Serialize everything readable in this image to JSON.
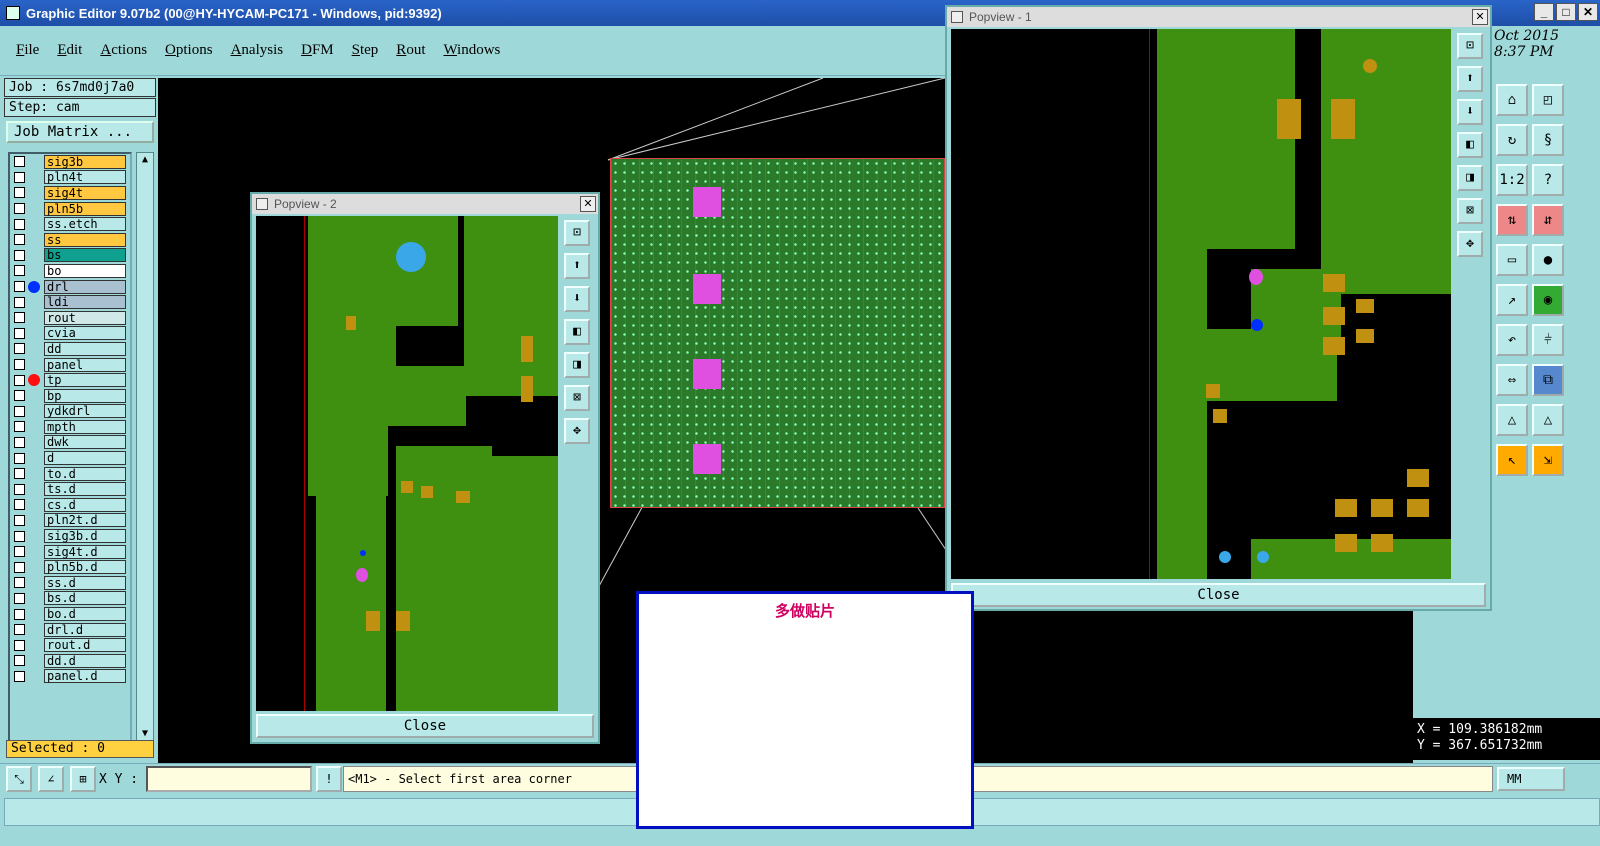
{
  "window": {
    "title": "Graphic Editor 9.07b2 (00@HY-HYCAM-PC171 - Windows, pid:9392)"
  },
  "menu": [
    "File",
    "Edit",
    "Actions",
    "Options",
    "Analysis",
    "DFM",
    "Step",
    "Rout",
    "Windows"
  ],
  "job": {
    "job_label": "Job : 6s7md0j7a0",
    "step_label": "Step: cam",
    "job_matrix": "Job Matrix ..."
  },
  "layers": [
    {
      "name": "sig3b",
      "color": "#ffc840"
    },
    {
      "name": "pln4t",
      "color": "#b8e8e8"
    },
    {
      "name": "sig4t",
      "color": "#ffc840"
    },
    {
      "name": "pln5b",
      "color": "#ffc840"
    },
    {
      "name": "ss.etch",
      "color": "#b8e8e8"
    },
    {
      "name": "ss",
      "color": "#ffc840"
    },
    {
      "name": "bs",
      "color": "#10a090"
    },
    {
      "name": "bo",
      "color": "#ffffff"
    },
    {
      "name": "drl",
      "color": "#a8c0d0",
      "dot": "#0030ff"
    },
    {
      "name": "ldi",
      "color": "#a8c0d0"
    },
    {
      "name": "rout",
      "color": "#d0e8e8"
    },
    {
      "name": "cvia",
      "color": "#b8e8e8"
    },
    {
      "name": "dd",
      "color": "#b8e8e8"
    },
    {
      "name": "panel",
      "color": "#b8e8e8"
    },
    {
      "name": "tp",
      "color": "#b8e8e8",
      "dot": "#ff1010"
    },
    {
      "name": "bp",
      "color": "#b8e8e8"
    },
    {
      "name": "ydkdrl",
      "color": "#b8e8e8"
    },
    {
      "name": "mpth",
      "color": "#b8e8e8"
    },
    {
      "name": "dwk",
      "color": "#b8e8e8"
    },
    {
      "name": "d",
      "color": "#b8e8e8"
    },
    {
      "name": "to.d",
      "color": "#b8e8e8"
    },
    {
      "name": "ts.d",
      "color": "#b8e8e8"
    },
    {
      "name": "cs.d",
      "color": "#b8e8e8"
    },
    {
      "name": "pln2t.d",
      "color": "#b8e8e8"
    },
    {
      "name": "sig3b.d",
      "color": "#b8e8e8"
    },
    {
      "name": "sig4t.d",
      "color": "#b8e8e8"
    },
    {
      "name": "pln5b.d",
      "color": "#b8e8e8"
    },
    {
      "name": "ss.d",
      "color": "#b8e8e8"
    },
    {
      "name": "bs.d",
      "color": "#b8e8e8"
    },
    {
      "name": "bo.d",
      "color": "#b8e8e8"
    },
    {
      "name": "drl.d",
      "color": "#b8e8e8"
    },
    {
      "name": "rout.d",
      "color": "#b8e8e8"
    },
    {
      "name": "dd.d",
      "color": "#b8e8e8"
    },
    {
      "name": "panel.d",
      "color": "#b8e8e8"
    }
  ],
  "selected": "Selected : 0",
  "popview2": {
    "title": "Popview - 2",
    "close": "Close"
  },
  "popview1": {
    "title": "Popview - 1",
    "close": "Close"
  },
  "datetime": {
    "date": "Oct 2015",
    "time": "8:37 PM"
  },
  "coords": {
    "x": "X =  109.386182mm",
    "y": "Y =  367.651732mm"
  },
  "command": {
    "xy_label": "X Y :",
    "xy_value": "",
    "message": "<M1> - Select first area corner",
    "unit": "MM"
  },
  "overlay": {
    "text": "多做贴片"
  }
}
